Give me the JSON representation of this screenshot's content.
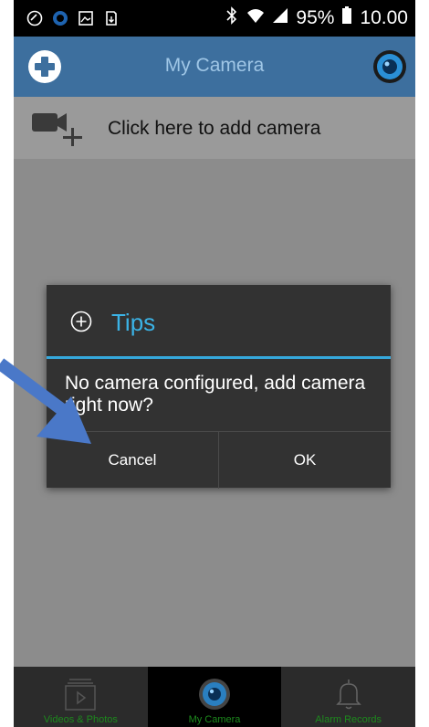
{
  "status_bar": {
    "battery": "95%",
    "time": "10.00"
  },
  "app_bar": {
    "title": "My Camera"
  },
  "add_camera": {
    "label": "Click here to add camera"
  },
  "dialog": {
    "title": "Tips",
    "message": "No camera configured, add camera right now?",
    "cancel_label": "Cancel",
    "ok_label": "OK"
  },
  "tabs": [
    {
      "label": "Videos & Photos",
      "icon": "video-gallery-icon"
    },
    {
      "label": "My Camera",
      "icon": "camera-lens-icon"
    },
    {
      "label": "Alarm Records",
      "icon": "bell-icon"
    }
  ],
  "colors": {
    "app_bar": "#3d6f9e",
    "dialog_accent": "#3bb3e6",
    "tab_label": "#1d8a1d",
    "arrow": "#4a78c8"
  }
}
